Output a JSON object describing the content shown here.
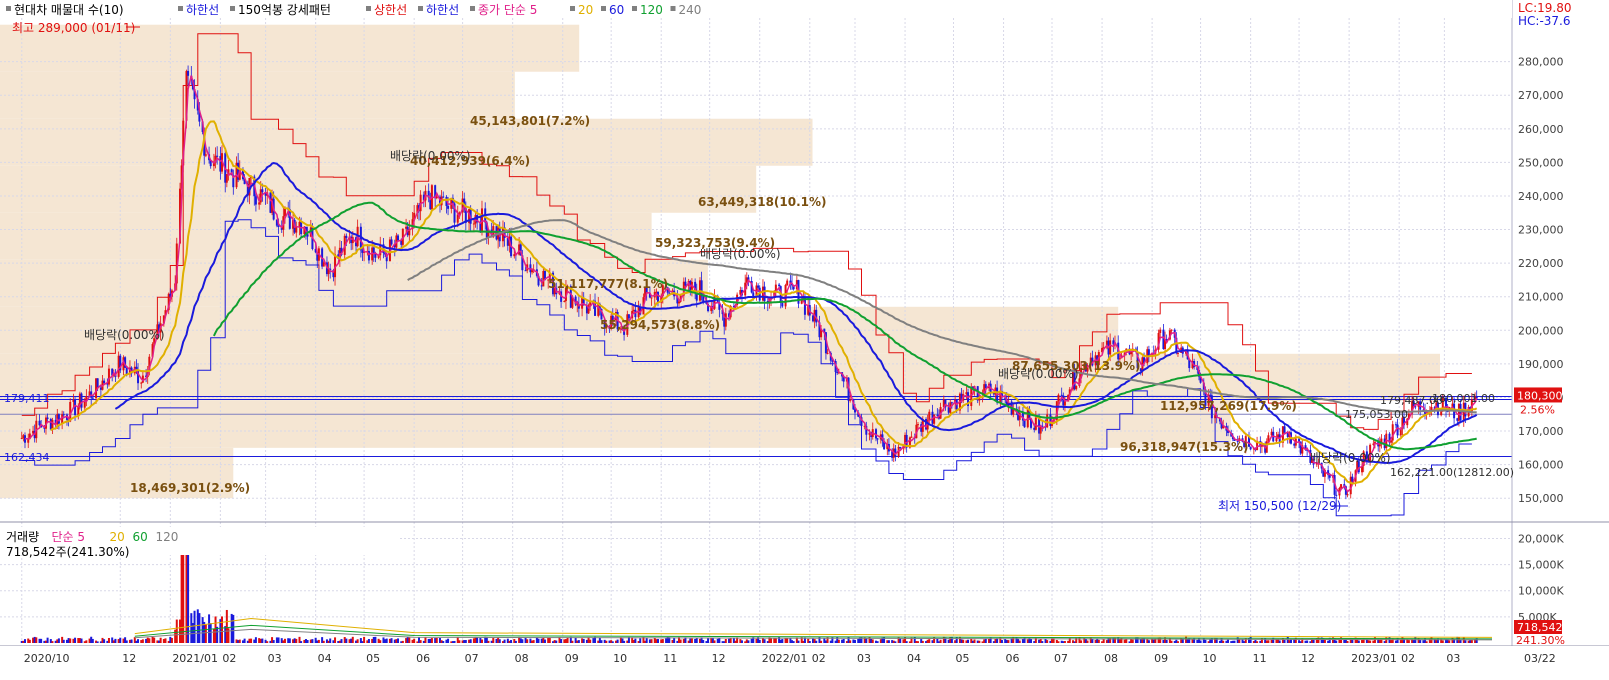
{
  "header": {
    "items": [
      {
        "text": "현대차 매물대 수(10)",
        "color": "#000000"
      },
      {
        "text": "하한선",
        "color": "#1a1adc"
      },
      {
        "text": "150억봉 강세패턴",
        "color": "#000000"
      },
      {
        "text": "상한선",
        "color": "#e01010"
      },
      {
        "text": "하한선",
        "color": "#1a1adc"
      },
      {
        "text": "종가 단순 5",
        "color": "#e0208a"
      },
      {
        "text": "20",
        "color": "#e0b000"
      },
      {
        "text": "60",
        "color": "#1a1adc"
      },
      {
        "text": "120",
        "color": "#10a030"
      },
      {
        "text": "240",
        "color": "#808080"
      }
    ],
    "lc_label": "LC:19.80",
    "hc_label": "HC:-37.6"
  },
  "volume_header": {
    "items": [
      {
        "text": "거래량",
        "color": "#000000"
      },
      {
        "text": "단순 5",
        "color": "#e0208a"
      },
      {
        "text": "20",
        "color": "#e0b000"
      },
      {
        "text": "60",
        "color": "#10a030"
      },
      {
        "text": "120",
        "color": "#808080"
      }
    ],
    "last_volume": "718,542주(241.30%)"
  },
  "annotations": {
    "high": "최고 289,000 (01/11)",
    "low": "최저 150,500 (12/29)",
    "left_levels": [
      "179,411",
      "162,434"
    ],
    "volume_profile_labels": [
      "45,143,801(7.2%)",
      "40,412,939(6.4%)",
      "63,449,318(10.1%)",
      "59,323,753(9.4%)",
      "51,117,777(8.1%)",
      "55,294,573(8.8%)",
      "87,655,303(13.9%)",
      "112,957,269(17.9%)",
      "96,318,947(15.3%)",
      "18,469,301(2.9%)"
    ],
    "dividend_labels": [
      "배당락(0.00%)",
      "배당락(0.00%)",
      "배당락(0.00%)",
      "배당락(0.00%)",
      "배당락(0.00%)"
    ],
    "right_cluster": [
      "179,487.00",
      "180,001.00",
      "175,053.00",
      "162,221.00(12812.00)"
    ],
    "current_price": "180,300",
    "current_change": "2.56%",
    "current_volume": "718,542",
    "current_volume_pct": "241.30%"
  },
  "chart_data": {
    "type": "candlestick",
    "title": "현대차",
    "price_axis": {
      "ticks": [
        "150,000",
        "160,000",
        "170,000",
        "180,000",
        "190,000",
        "200,000",
        "210,000",
        "220,000",
        "230,000",
        "240,000",
        "250,000",
        "260,000",
        "270,000",
        "280,000"
      ],
      "range": [
        145000,
        293000
      ]
    },
    "volume_axis": {
      "ticks": [
        "5,000K",
        "10,000K",
        "15,000K",
        "20,000K"
      ],
      "range": [
        0,
        22000
      ]
    },
    "x_axis": {
      "labels": [
        "2020/10",
        "12",
        "2021/01",
        "02",
        "03",
        "04",
        "05",
        "06",
        "07",
        "08",
        "09",
        "10",
        "11",
        "12",
        "2022/01",
        "02",
        "03",
        "04",
        "05",
        "06",
        "07",
        "08",
        "09",
        "10",
        "11",
        "12",
        "2023/01",
        "02",
        "03",
        "03/22"
      ]
    },
    "close_series": {
      "dates": [
        "2020-10-01",
        "2020-10-15",
        "2020-11-01",
        "2020-11-15",
        "2020-12-01",
        "2020-12-15",
        "2021-01-04",
        "2021-01-11",
        "2021-01-25",
        "2021-02-10",
        "2021-02-25",
        "2021-03-10",
        "2021-03-25",
        "2021-04-10",
        "2021-04-25",
        "2021-05-10",
        "2021-05-25",
        "2021-06-10",
        "2021-06-25",
        "2021-07-10",
        "2021-07-25",
        "2021-08-10",
        "2021-08-25",
        "2021-09-10",
        "2021-09-25",
        "2021-10-10",
        "2021-10-25",
        "2021-11-10",
        "2021-11-25",
        "2021-12-10",
        "2021-12-25",
        "2022-01-10",
        "2022-01-25",
        "2022-02-10",
        "2022-02-25",
        "2022-03-10",
        "2022-03-25",
        "2022-04-10",
        "2022-04-25",
        "2022-05-10",
        "2022-05-25",
        "2022-06-10",
        "2022-06-25",
        "2022-07-10",
        "2022-07-25",
        "2022-08-10",
        "2022-08-25",
        "2022-09-10",
        "2022-09-25",
        "2022-10-10",
        "2022-10-25",
        "2022-11-10",
        "2022-11-25",
        "2022-12-10",
        "2022-12-29",
        "2023-01-10",
        "2023-01-25",
        "2023-02-10",
        "2023-02-25",
        "2023-03-10",
        "2023-03-22"
      ],
      "close": [
        168000,
        172000,
        176000,
        182000,
        190000,
        186000,
        214000,
        275000,
        252000,
        246000,
        241000,
        234000,
        232000,
        218000,
        229000,
        222000,
        226000,
        240000,
        236000,
        234000,
        228000,
        220000,
        214000,
        209000,
        204000,
        201000,
        211000,
        211000,
        212000,
        204000,
        215000,
        210000,
        212000,
        198000,
        182000,
        170000,
        163000,
        171000,
        178000,
        180000,
        182000,
        176000,
        170000,
        182000,
        192000,
        195000,
        190000,
        199000,
        190000,
        175000,
        168000,
        166000,
        170000,
        160000,
        151000,
        162000,
        168000,
        177000,
        178000,
        175000,
        180300
      ]
    },
    "moving_averages": [
      {
        "name": "20",
        "color": "#e0b000"
      },
      {
        "name": "60",
        "color": "#1a1adc"
      },
      {
        "name": "120",
        "color": "#10a030"
      },
      {
        "name": "240",
        "color": "#808080"
      }
    ],
    "volume_profile": [
      {
        "from": 150000,
        "to": 165000,
        "value": 18469301,
        "pct": 2.9
      },
      {
        "from": 165000,
        "to": 179000,
        "value": 96318947,
        "pct": 15.3
      },
      {
        "from": 179000,
        "to": 193000,
        "value": 112957269,
        "pct": 17.9
      },
      {
        "from": 193000,
        "to": 207000,
        "value": 87655303,
        "pct": 13.9
      },
      {
        "from": 207000,
        "to": 221000,
        "value": 55294573,
        "pct": 8.8
      },
      {
        "from": 221000,
        "to": 235000,
        "value": 51117777,
        "pct": 8.1
      },
      {
        "from": 235000,
        "to": 249000,
        "value": 59323753,
        "pct": 9.4
      },
      {
        "from": 249000,
        "to": 263000,
        "value": 63449318,
        "pct": 10.1
      },
      {
        "from": 263000,
        "to": 277000,
        "value": 40412939,
        "pct": 6.4
      },
      {
        "from": 277000,
        "to": 291000,
        "value": 45143801,
        "pct": 7.2
      }
    ],
    "horizontal_lines": [
      179411,
      162434,
      180300
    ],
    "volume_series": {
      "spike_index": 7,
      "spike_value": 20000
    }
  },
  "colors": {
    "up": "#e01010",
    "down": "#1a1adc",
    "profile": "#f5e6d3",
    "grid": "#d8d8e8",
    "axis_bg": "#ffffff"
  }
}
